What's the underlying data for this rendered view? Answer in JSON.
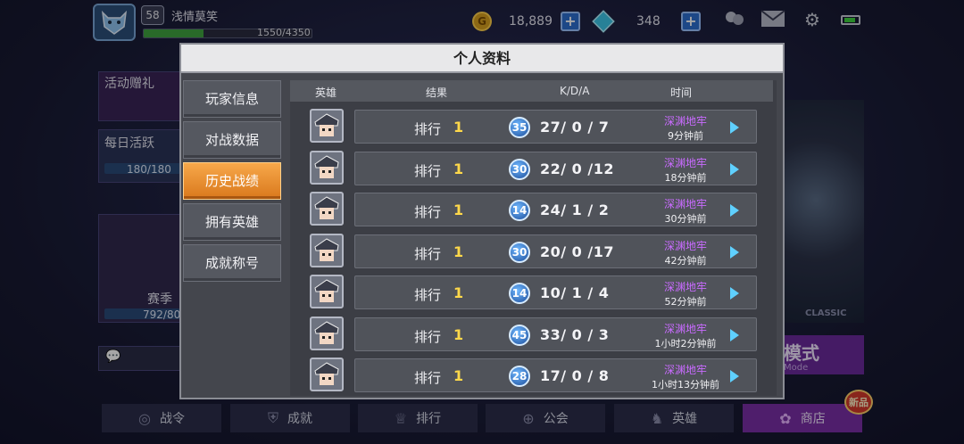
{
  "player": {
    "level": "58",
    "name": "浅情莫笑",
    "xp_text": "1550/4350",
    "xp_fraction": 0.356
  },
  "currency": {
    "coins": "18,889",
    "gems": "348",
    "coin_symbol": "G"
  },
  "background": {
    "activity_gift": "活动赠礼",
    "daily_active": "每日活跃",
    "daily_progress": "180/180",
    "season_label": "赛季",
    "season_progress": "792/80",
    "classic_tag": "CLASSIC",
    "mode_title": "模式",
    "mode_sub": "Mode"
  },
  "bottom_nav": [
    {
      "label": "战令",
      "icon": "target-icon"
    },
    {
      "label": "成就",
      "icon": "shield-icon"
    },
    {
      "label": "排行",
      "icon": "trophy-icon"
    },
    {
      "label": "公会",
      "icon": "guild-icon"
    },
    {
      "label": "英雄",
      "icon": "helmet-icon"
    },
    {
      "label": "商店",
      "icon": "shop-icon"
    }
  ],
  "new_badge": "新品",
  "modal": {
    "title": "个人资料",
    "tabs": [
      {
        "label": "玩家信息",
        "active": false
      },
      {
        "label": "对战数据",
        "active": false
      },
      {
        "label": "历史战绩",
        "active": true
      },
      {
        "label": "拥有英雄",
        "active": false
      },
      {
        "label": "成就称号",
        "active": false
      }
    ],
    "columns": {
      "hero": "英雄",
      "result": "结果",
      "kda": "K/D/A",
      "time": "时间"
    },
    "rank_label": "排行",
    "rows": [
      {
        "rank": "1",
        "level": "35",
        "kda": "27/ 0 / 7",
        "mode": "深渊地牢",
        "time": "9分钟前"
      },
      {
        "rank": "1",
        "level": "30",
        "kda": "22/ 0 /12",
        "mode": "深渊地牢",
        "time": "18分钟前"
      },
      {
        "rank": "1",
        "level": "14",
        "kda": "24/ 1 / 2",
        "mode": "深渊地牢",
        "time": "30分钟前"
      },
      {
        "rank": "1",
        "level": "30",
        "kda": "20/ 0 /17",
        "mode": "深渊地牢",
        "time": "42分钟前"
      },
      {
        "rank": "1",
        "level": "14",
        "kda": "10/ 1 / 4",
        "mode": "深渊地牢",
        "time": "52分钟前"
      },
      {
        "rank": "1",
        "level": "45",
        "kda": "33/ 0 / 3",
        "mode": "深渊地牢",
        "time": "1小时2分钟前"
      },
      {
        "rank": "1",
        "level": "28",
        "kda": "17/ 0 / 8",
        "mode": "深渊地牢",
        "time": "1小时13分钟前"
      }
    ]
  },
  "colors": {
    "accent_orange": "#e8892a",
    "rank_gold": "#ffd84a",
    "mode_purple": "#c96bff"
  }
}
